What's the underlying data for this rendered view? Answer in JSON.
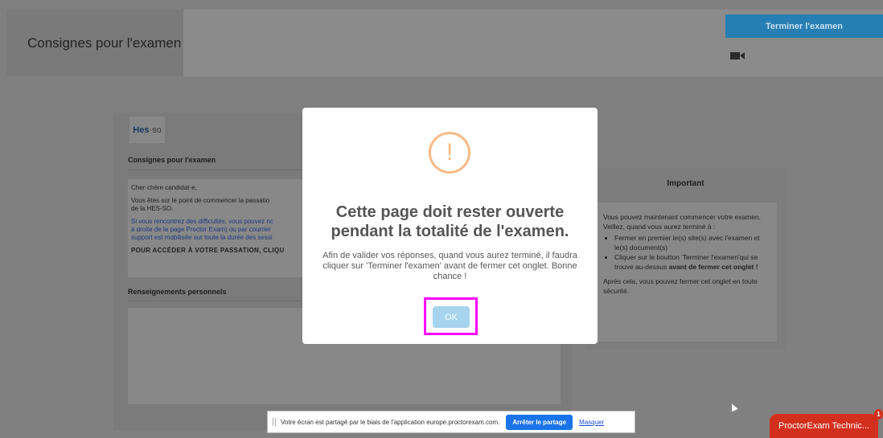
{
  "header": {
    "title": "Consignes pour l'examen",
    "finish_button": "Terminer l'examen",
    "camera_icon": "video-camera-icon"
  },
  "instructions": {
    "logo_hes": "Hes",
    "logo_so": "·so",
    "heading": "Consignes pour l'examen",
    "greeting": "Cher·chère candidat·e,",
    "para1_line1": "Vous êtes sur le point de commencer la passatio",
    "para1_line2": "de la HES-SO.",
    "para2_line1": "Si vous rencontrez des difficultés, vous pouvez nc",
    "para2_line2": "à droite de la page Proctor Exam) ou par courrier",
    "para2_line3": "support est mobilisée sur toute la durée des sessi",
    "para3_cut": "POUR ACCÉDER À VOTRE PASSATION, CLIQU",
    "personal_heading": "Renseignements personnels"
  },
  "important": {
    "title": "Important",
    "intro": "Vous pouvez maintenant commencer votre examen. Veillez, quand vous aurez terminé à :",
    "bullet1": "Fermer en premier le(s) site(s) avec l'examen et le(s) document(s)",
    "bullet2_pre": "Cliquer sur le boutton 'Terminer l'examen'qui se trouve au-dessus ",
    "bullet2_bold": "avant de fermer cet onglet !",
    "outro": "Après cela, vous pouvez fermer cet onglet en toute sécurité."
  },
  "modal": {
    "icon": "warning-exclamation-icon",
    "icon_glyph": "!",
    "title": "Cette page doit rester ouverte pendant la totalité de l'examen.",
    "text": "Afin de valider vos réponses, quand vous aurez terminé, il faudra cliquer sur 'Terminer l'examen' avant de fermer cet onglet. Bonne chance !",
    "ok_label": "OK",
    "accent_color": "#f8ba86",
    "highlight_color": "#ff00ff"
  },
  "share_bar": {
    "text": "Votre écran est partagé par le biais de l'application europe.proctorexam.com.",
    "stop_label": "Arrêter le partage",
    "hide_label": "Masquer"
  },
  "chat": {
    "label": "ProctorExam Technic...",
    "badge": "1"
  }
}
